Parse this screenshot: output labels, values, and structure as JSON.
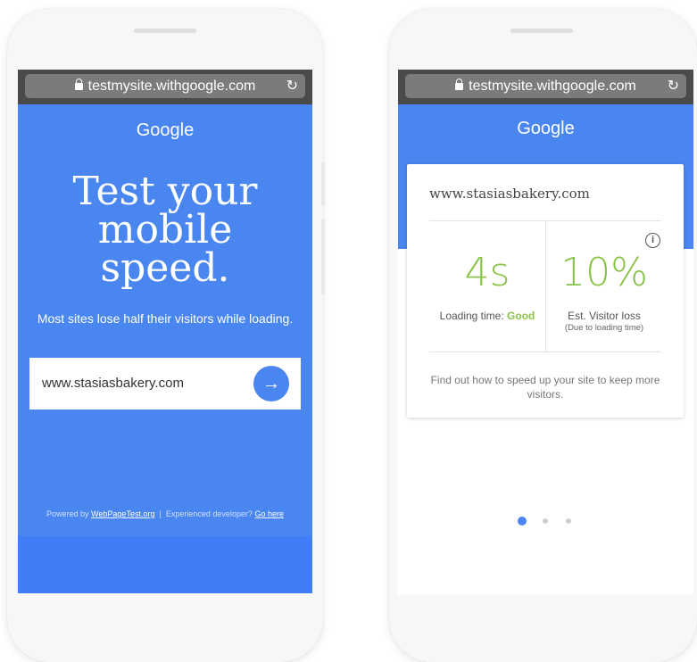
{
  "browser": {
    "url": "testmysite.withgoogle.com",
    "reload_icon": "reload-icon",
    "lock_icon": "lock-icon"
  },
  "left_screen": {
    "logo": "Google",
    "headline": [
      "Test your",
      "mobile",
      "speed."
    ],
    "subtitle": "Most sites lose half their visitors while loading.",
    "url_input": "www.stasiasbakery.com",
    "go_icon": "arrow-right-icon",
    "footer": {
      "powered_by": "Powered by",
      "webpagetest_link": "WebPageTest.org",
      "separator": "|",
      "dev_text": "Experienced developer?",
      "go_here_link": "Go here"
    }
  },
  "right_screen": {
    "logo": "Google",
    "site": "www.stasiasbakery.com",
    "loading_time": {
      "value": "4s",
      "label": "Loading time:",
      "rating": "Good"
    },
    "visitor_loss": {
      "value": "10%",
      "label": "Est. Visitor loss",
      "sublabel": "(Due to loading time)"
    },
    "info_icon": "info-icon",
    "tip": "Find out how to speed up your site to keep more visitors.",
    "pagination": {
      "total": 3,
      "active": 1
    }
  },
  "colors": {
    "brand_blue": "#4a86f0",
    "good_green": "#8bc34a",
    "browser_chrome": "#4a4a4a",
    "inactive_dot": "#d0d0d0"
  }
}
